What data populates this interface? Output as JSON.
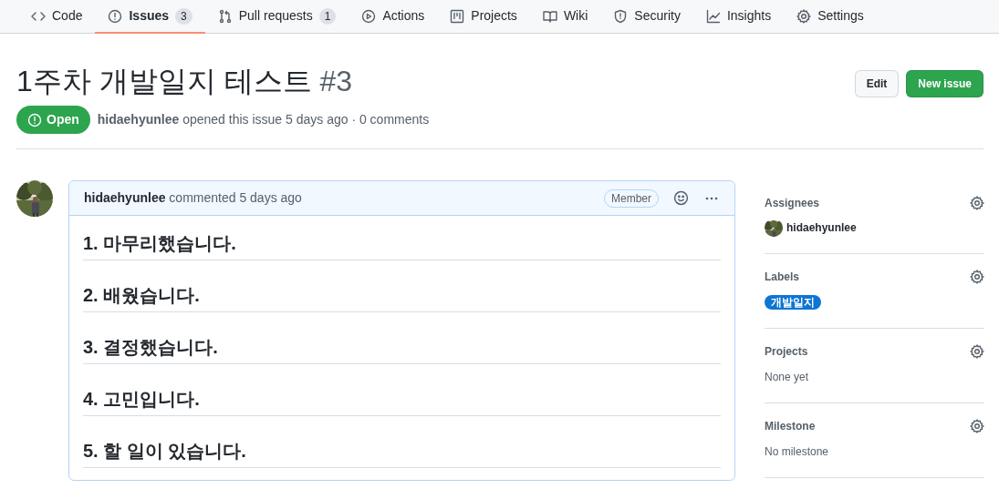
{
  "tabs": [
    {
      "label": "Code",
      "selected": false
    },
    {
      "label": "Issues",
      "count": "3",
      "selected": true
    },
    {
      "label": "Pull requests",
      "count": "1",
      "selected": false
    },
    {
      "label": "Actions",
      "selected": false
    },
    {
      "label": "Projects",
      "selected": false
    },
    {
      "label": "Wiki",
      "selected": false
    },
    {
      "label": "Security",
      "selected": false
    },
    {
      "label": "Insights",
      "selected": false
    },
    {
      "label": "Settings",
      "selected": false
    }
  ],
  "issue": {
    "title": "1주차 개발일지 테스트",
    "number": "#3",
    "state": "Open",
    "author": "hidaehyunlee",
    "meta": "opened this issue 5 days ago · 0 comments"
  },
  "buttons": [
    {
      "label": "Edit",
      "kind": "secondary"
    },
    {
      "label": "New issue",
      "kind": "primary"
    }
  ],
  "comment": {
    "author": "hidaehyunlee",
    "meta": "commented 5 days ago",
    "role": "Member",
    "items": [
      "1. 마무리했습니다.",
      "2. 배웠습니다.",
      "3. 결정했습니다.",
      "4. 고민입니다.",
      "5. 할 일이 있습니다."
    ]
  },
  "sidebar": [
    {
      "heading": "Assignees",
      "kind": "user",
      "text": "hidaehyunlee"
    },
    {
      "heading": "Labels",
      "kind": "label",
      "text": "개발일지",
      "color": "#0e75d4"
    },
    {
      "heading": "Projects",
      "kind": "text",
      "text": "None yet"
    },
    {
      "heading": "Milestone",
      "kind": "text",
      "text": "No milestone"
    }
  ]
}
